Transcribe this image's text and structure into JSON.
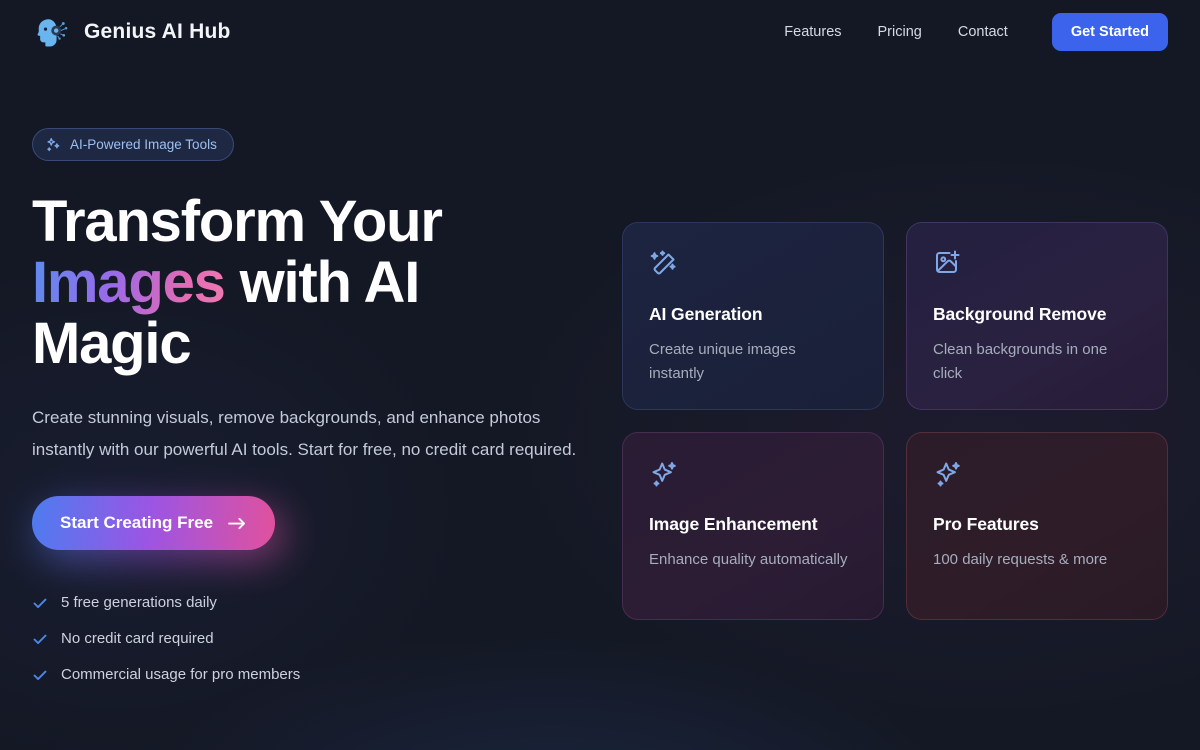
{
  "header": {
    "logo_icon": "ai-head-circuit-icon",
    "brand_name": "Genius AI Hub",
    "nav_links": [
      {
        "label": "Features"
      },
      {
        "label": "Pricing"
      },
      {
        "label": "Contact"
      }
    ],
    "cta_label": "Get Started"
  },
  "hero": {
    "badge": {
      "icon": "sparkles-icon",
      "text": "AI-Powered Image Tools"
    },
    "headline_part1": "Transform Your ",
    "headline_highlight": "Images",
    "headline_part2": " with AI Magic",
    "subcopy": "Create stunning visuals, remove backgrounds, and enhance photos instantly with our powerful AI tools. Start for free, no credit card required.",
    "cta_label": "Start Creating Free",
    "cta_icon": "arrow-right-icon",
    "checklist": [
      {
        "icon": "check-icon",
        "label": "5 free generations daily"
      },
      {
        "icon": "check-icon",
        "label": "No credit card required"
      },
      {
        "icon": "check-icon",
        "label": "Commercial usage for pro members"
      }
    ]
  },
  "feature_cards": [
    {
      "icon": "magic-wand-icon",
      "title": "AI Generation",
      "description": "Create unique images instantly"
    },
    {
      "icon": "image-plus-icon",
      "title": "Background Remove",
      "description": "Clean backgrounds in one click"
    },
    {
      "icon": "sparkles-icon",
      "title": "Image Enhancement",
      "description": "Enhance quality automatically"
    },
    {
      "icon": "sparkles-icon",
      "title": "Pro Features",
      "description": "100 daily requests & more"
    }
  ],
  "colors": {
    "background": "#141824",
    "accent_blue": "#3b63eb",
    "badge_text": "#9cc0f2",
    "icon_blue": "#7fa8e8",
    "gradient_start": "#4d7cf0",
    "gradient_mid": "#9b55e4",
    "gradient_end": "#e1519d",
    "check_blue": "#4c86e8"
  }
}
